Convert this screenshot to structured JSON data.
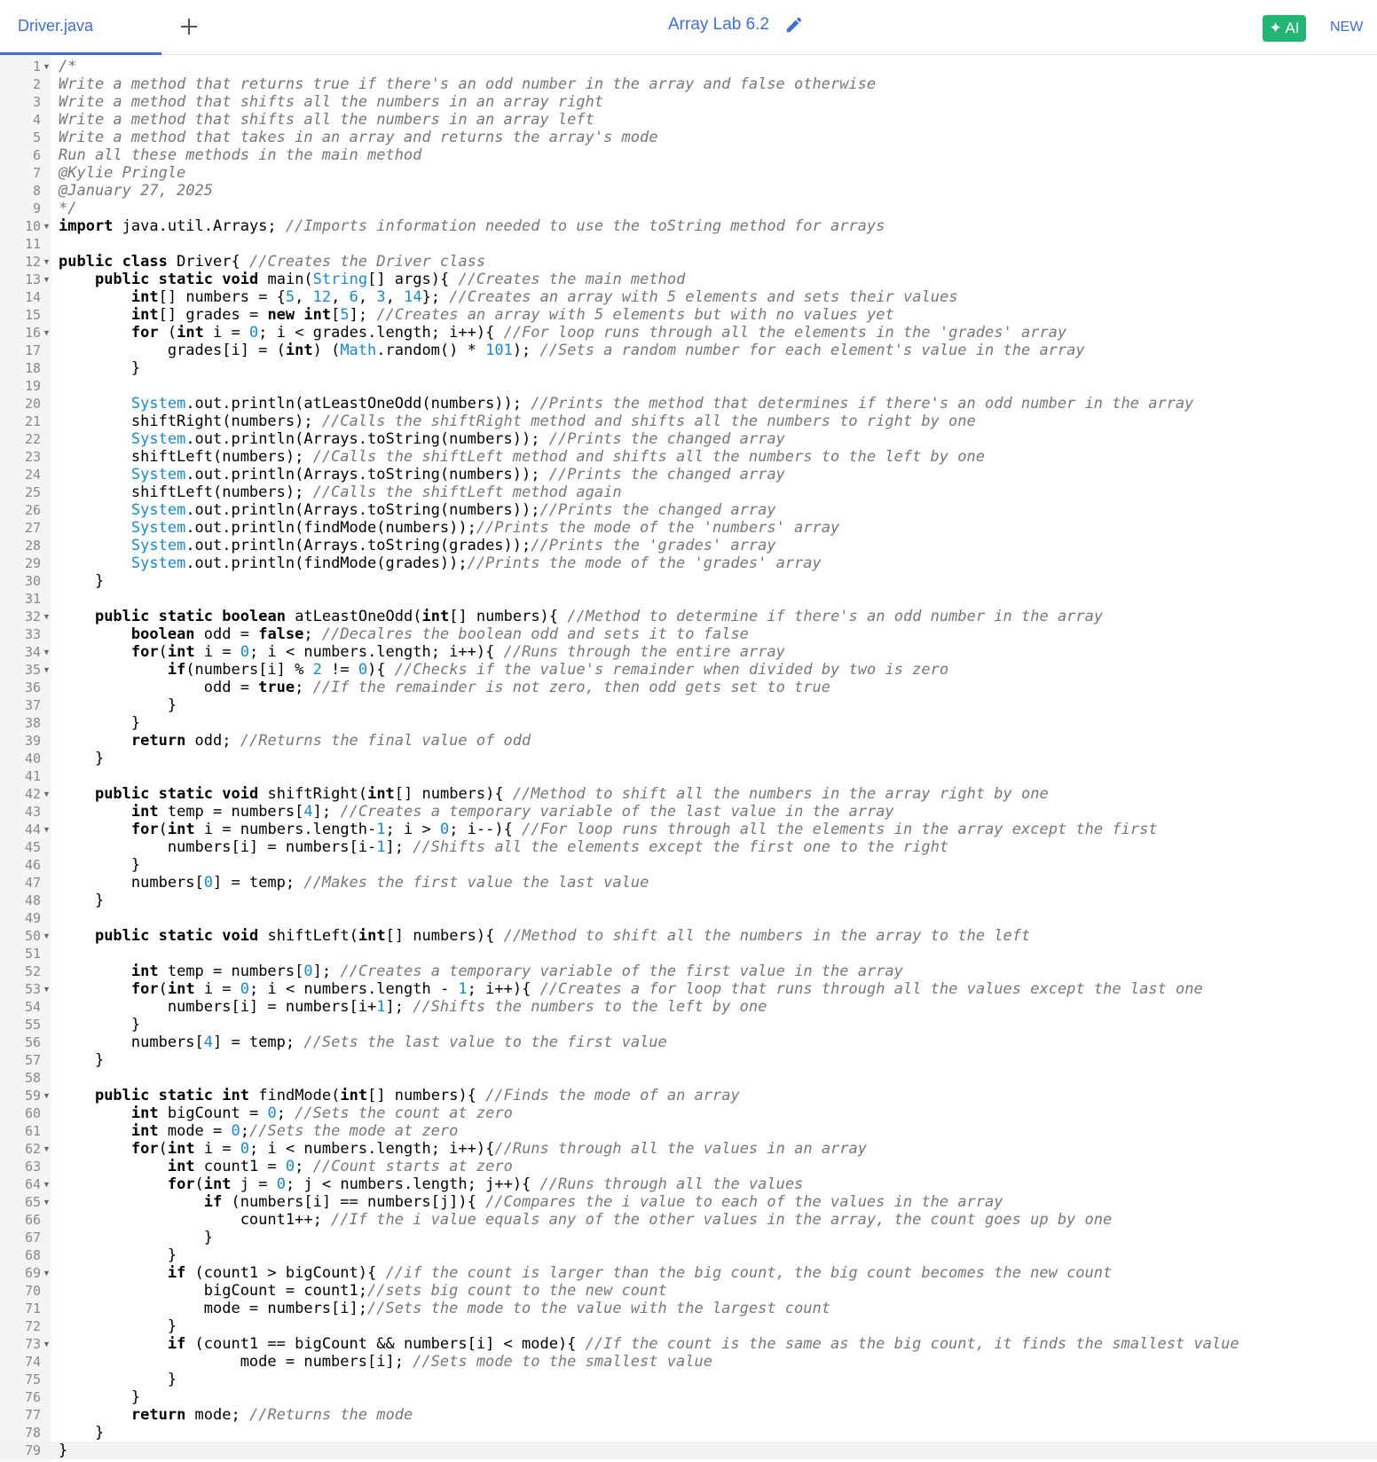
{
  "tabs": [
    {
      "label": "Driver.java"
    }
  ],
  "title": "Array Lab 6.2",
  "ai_button": "AI",
  "new_label": "NEW",
  "code_lines": [
    "/*",
    "Write a method that returns true if there's an odd number in the array and false otherwise",
    "Write a method that shifts all the numbers in an array right",
    "Write a method that shifts all the numbers in an array left",
    "Write a method that takes in an array and returns the array's mode",
    "Run all these methods in the main method",
    "@Kylie Pringle",
    "@January 27, 2025",
    "*/",
    "import java.util.Arrays; //Imports information needed to use the toString method for arrays",
    "",
    "public class Driver{ //Creates the Driver class",
    "    public static void main(String[] args){ //Creates the main method",
    "        int[] numbers = {5, 12, 6, 3, 14}; //Creates an array with 5 elements and sets their values",
    "        int[] grades = new int[5]; //Creates an array with 5 elements but with no values yet",
    "        for (int i = 0; i < grades.length; i++){ //For loop runs through all the elements in the 'grades' array",
    "            grades[i] = (int) (Math.random() * 101); //Sets a random number for each element's value in the array",
    "        }",
    "",
    "        System.out.println(atLeastOneOdd(numbers)); //Prints the method that determines if there's an odd number in the array",
    "        shiftRight(numbers); //Calls the shiftRight method and shifts all the numbers to right by one",
    "        System.out.println(Arrays.toString(numbers)); //Prints the changed array",
    "        shiftLeft(numbers); //Calls the shiftLeft method and shifts all the numbers to the left by one",
    "        System.out.println(Arrays.toString(numbers)); //Prints the changed array",
    "        shiftLeft(numbers); //Calls the shiftLeft method again",
    "        System.out.println(Arrays.toString(numbers));//Prints the changed array",
    "        System.out.println(findMode(numbers));//Prints the mode of the 'numbers' array",
    "        System.out.println(Arrays.toString(grades));//Prints the 'grades' array",
    "        System.out.println(findMode(grades));//Prints the mode of the 'grades' array",
    "    }",
    "",
    "    public static boolean atLeastOneOdd(int[] numbers){ //Method to determine if there's an odd number in the array",
    "        boolean odd = false; //Decalres the boolean odd and sets it to false",
    "        for(int i = 0; i < numbers.length; i++){ //Runs through the entire array",
    "            if(numbers[i] % 2 != 0){ //Checks if the value's remainder when divided by two is zero",
    "                odd = true; //If the remainder is not zero, then odd gets set to true",
    "            }",
    "        }",
    "        return odd; //Returns the final value of odd",
    "    }",
    "",
    "    public static void shiftRight(int[] numbers){ //Method to shift all the numbers in the array right by one",
    "        int temp = numbers[4]; //Creates a temporary variable of the last value in the array",
    "        for(int i = numbers.length-1; i > 0; i--){ //For loop runs through all the elements in the array except the first",
    "            numbers[i] = numbers[i-1]; //Shifts all the elements except the first one to the right",
    "        }",
    "        numbers[0] = temp; //Makes the first value the last value",
    "    }",
    "",
    "    public static void shiftLeft(int[] numbers){ //Method to shift all the numbers in the array to the left",
    "",
    "        int temp = numbers[0]; //Creates a temporary variable of the first value in the array",
    "        for(int i = 0; i < numbers.length - 1; i++){ //Creates a for loop that runs through all the values except the last one",
    "            numbers[i] = numbers[i+1]; //Shifts the numbers to the left by one",
    "        }",
    "        numbers[4] = temp; //Sets the last value to the first value",
    "    }",
    "",
    "    public static int findMode(int[] numbers){ //Finds the mode of an array",
    "        int bigCount = 0; //Sets the count at zero",
    "        int mode = 0;//Sets the mode at zero",
    "        for(int i = 0; i < numbers.length; i++){//Runs through all the values in an array",
    "            int count1 = 0; //Count starts at zero",
    "            for(int j = 0; j < numbers.length; j++){ //Runs through all the values",
    "                if (numbers[i] == numbers[j]){ //Compares the i value to each of the values in the array",
    "                    count1++; //If the i value equals any of the other values in the array, the count goes up by one",
    "                }",
    "            }",
    "            if (count1 > bigCount){ //if the count is larger than the big count, the big count becomes the new count",
    "                bigCount = count1;//sets big count to the new count",
    "                mode = numbers[i];//Sets the mode to the value with the largest count",
    "            }",
    "            if (count1 == bigCount && numbers[i] < mode){ //If the count is the same as the big count, it finds the smallest value",
    "                    mode = numbers[i]; //Sets mode to the smallest value",
    "            }",
    "        }",
    "        return mode; //Returns the mode",
    "    }",
    "}"
  ],
  "fold_lines": [
    1,
    10,
    12,
    13,
    16,
    32,
    34,
    35,
    42,
    44,
    50,
    53,
    59,
    62,
    64,
    65,
    69,
    73
  ],
  "colors": {
    "accent": "#3f6fd1",
    "ai_green": "#22b573",
    "comment": "#777777",
    "number": "#1a88c9"
  },
  "icons": [
    "add-tab-icon",
    "pencil-icon",
    "sparkle-icon",
    "fold-arrow-icon"
  ]
}
